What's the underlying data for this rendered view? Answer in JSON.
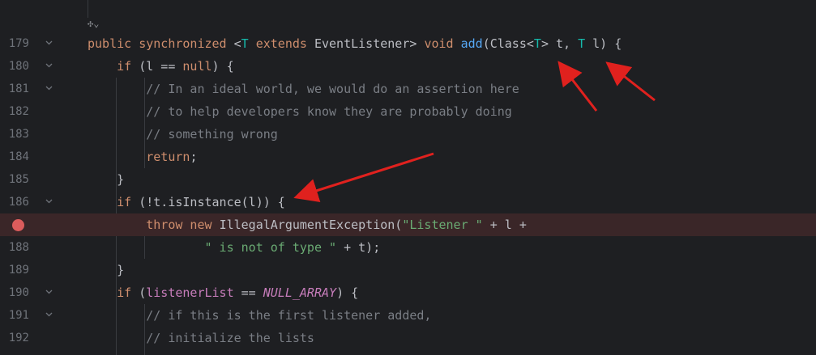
{
  "editor": {
    "hint_icon": "ai-assistant-icon",
    "breakpoint_color": "#db5c5c",
    "lines": [
      {
        "num": "179",
        "parts": [
          [
            "kw",
            "public synchronized "
          ],
          [
            "",
            "<"
          ],
          [
            "tp",
            "T"
          ],
          [
            "kw",
            " extends "
          ],
          [
            "",
            "EventListener> "
          ],
          [
            "kw",
            "void "
          ],
          [
            "fn",
            "add"
          ],
          [
            "",
            "(Class<"
          ],
          [
            "tp",
            "T"
          ],
          [
            "",
            "> t, "
          ],
          [
            "tp",
            "T"
          ],
          [
            "",
            " l) {"
          ]
        ]
      },
      {
        "num": "180",
        "parts": [
          [
            "",
            "    "
          ],
          [
            "kw",
            "if "
          ],
          [
            "",
            "(l == "
          ],
          [
            "kw",
            "null"
          ],
          [
            "",
            ") {"
          ]
        ]
      },
      {
        "num": "181",
        "parts": [
          [
            "",
            "        "
          ],
          [
            "cm",
            "// In an ideal world, we would do an assertion here"
          ]
        ]
      },
      {
        "num": "182",
        "parts": [
          [
            "",
            "        "
          ],
          [
            "cm",
            "// to help developers know they are probably doing"
          ]
        ]
      },
      {
        "num": "183",
        "parts": [
          [
            "",
            "        "
          ],
          [
            "cm",
            "// something wrong"
          ]
        ]
      },
      {
        "num": "184",
        "parts": [
          [
            "",
            "        "
          ],
          [
            "kw",
            "return"
          ],
          [
            "",
            ";"
          ]
        ]
      },
      {
        "num": "185",
        "parts": [
          [
            "",
            "    }"
          ]
        ]
      },
      {
        "num": "186",
        "parts": [
          [
            "",
            "    "
          ],
          [
            "kw",
            "if "
          ],
          [
            "",
            "(!t.isInstance(l)) {"
          ]
        ]
      },
      {
        "num": "",
        "breakpoint": true,
        "parts": [
          [
            "",
            "        "
          ],
          [
            "kw",
            "throw new "
          ],
          [
            "",
            "IllegalArgumentException("
          ],
          [
            "st",
            "\"Listener \""
          ],
          [
            "",
            " + l +"
          ]
        ]
      },
      {
        "num": "188",
        "parts": [
          [
            "",
            "                "
          ],
          [
            "st",
            "\" is not of type \""
          ],
          [
            "",
            " + t);"
          ]
        ]
      },
      {
        "num": "189",
        "parts": [
          [
            "",
            "    }"
          ]
        ]
      },
      {
        "num": "190",
        "parts": [
          [
            "",
            "    "
          ],
          [
            "kw",
            "if "
          ],
          [
            "",
            "("
          ],
          [
            "fld",
            "listenerList"
          ],
          [
            "",
            " == "
          ],
          [
            "cst",
            "NULL_ARRAY"
          ],
          [
            "",
            ") {"
          ]
        ]
      },
      {
        "num": "191",
        "parts": [
          [
            "",
            "        "
          ],
          [
            "cm",
            "// if this is the first listener added,"
          ]
        ]
      },
      {
        "num": "192",
        "parts": [
          [
            "",
            "        "
          ],
          [
            "cm",
            "// initialize the lists"
          ]
        ]
      }
    ]
  }
}
